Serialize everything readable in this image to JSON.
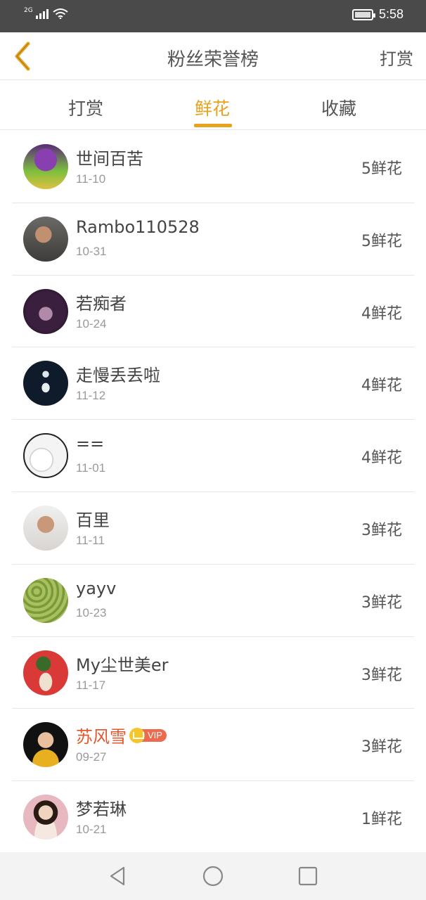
{
  "status_bar": {
    "network": "2G",
    "time": "5:58"
  },
  "header": {
    "title": "粉丝荣誉榜",
    "right_action": "打赏"
  },
  "tabs": [
    {
      "label": "打赏",
      "active": false
    },
    {
      "label": "鲜花",
      "active": true
    },
    {
      "label": "收藏",
      "active": false
    }
  ],
  "accent_color": "#e8a21e",
  "vip_badge": "VIP",
  "fans": [
    {
      "name": "世间百苦",
      "date": "11-10",
      "amount": "5鲜花",
      "vip": false,
      "avatar": "anime-girl-avatar"
    },
    {
      "name": "Rambo110528",
      "date": "10-31",
      "amount": "5鲜花",
      "vip": false,
      "avatar": "man-photo-avatar"
    },
    {
      "name": "若痴者",
      "date": "10-24",
      "amount": "4鲜花",
      "vip": false,
      "avatar": "dark-figure-avatar"
    },
    {
      "name": "走慢丢丢啦",
      "date": "11-12",
      "amount": "4鲜花",
      "vip": false,
      "avatar": "ballerina-avatar"
    },
    {
      "name": "==",
      "date": "11-01",
      "amount": "4鲜花",
      "vip": false,
      "avatar": "sketch-avatar"
    },
    {
      "name": "百里",
      "date": "11-11",
      "amount": "3鲜花",
      "vip": false,
      "avatar": "young-man-avatar"
    },
    {
      "name": "yayv",
      "date": "10-23",
      "amount": "3鲜花",
      "vip": false,
      "avatar": "green-texture-avatar"
    },
    {
      "name": "My尘世美er",
      "date": "11-17",
      "amount": "3鲜花",
      "vip": false,
      "avatar": "cartoon-red-avatar"
    },
    {
      "name": "苏风雪",
      "date": "09-27",
      "amount": "3鲜花",
      "vip": true,
      "avatar": "celebrity-avatar"
    },
    {
      "name": "梦若琳",
      "date": "10-21",
      "amount": "1鲜花",
      "vip": false,
      "avatar": "girl-photo-avatar"
    }
  ]
}
